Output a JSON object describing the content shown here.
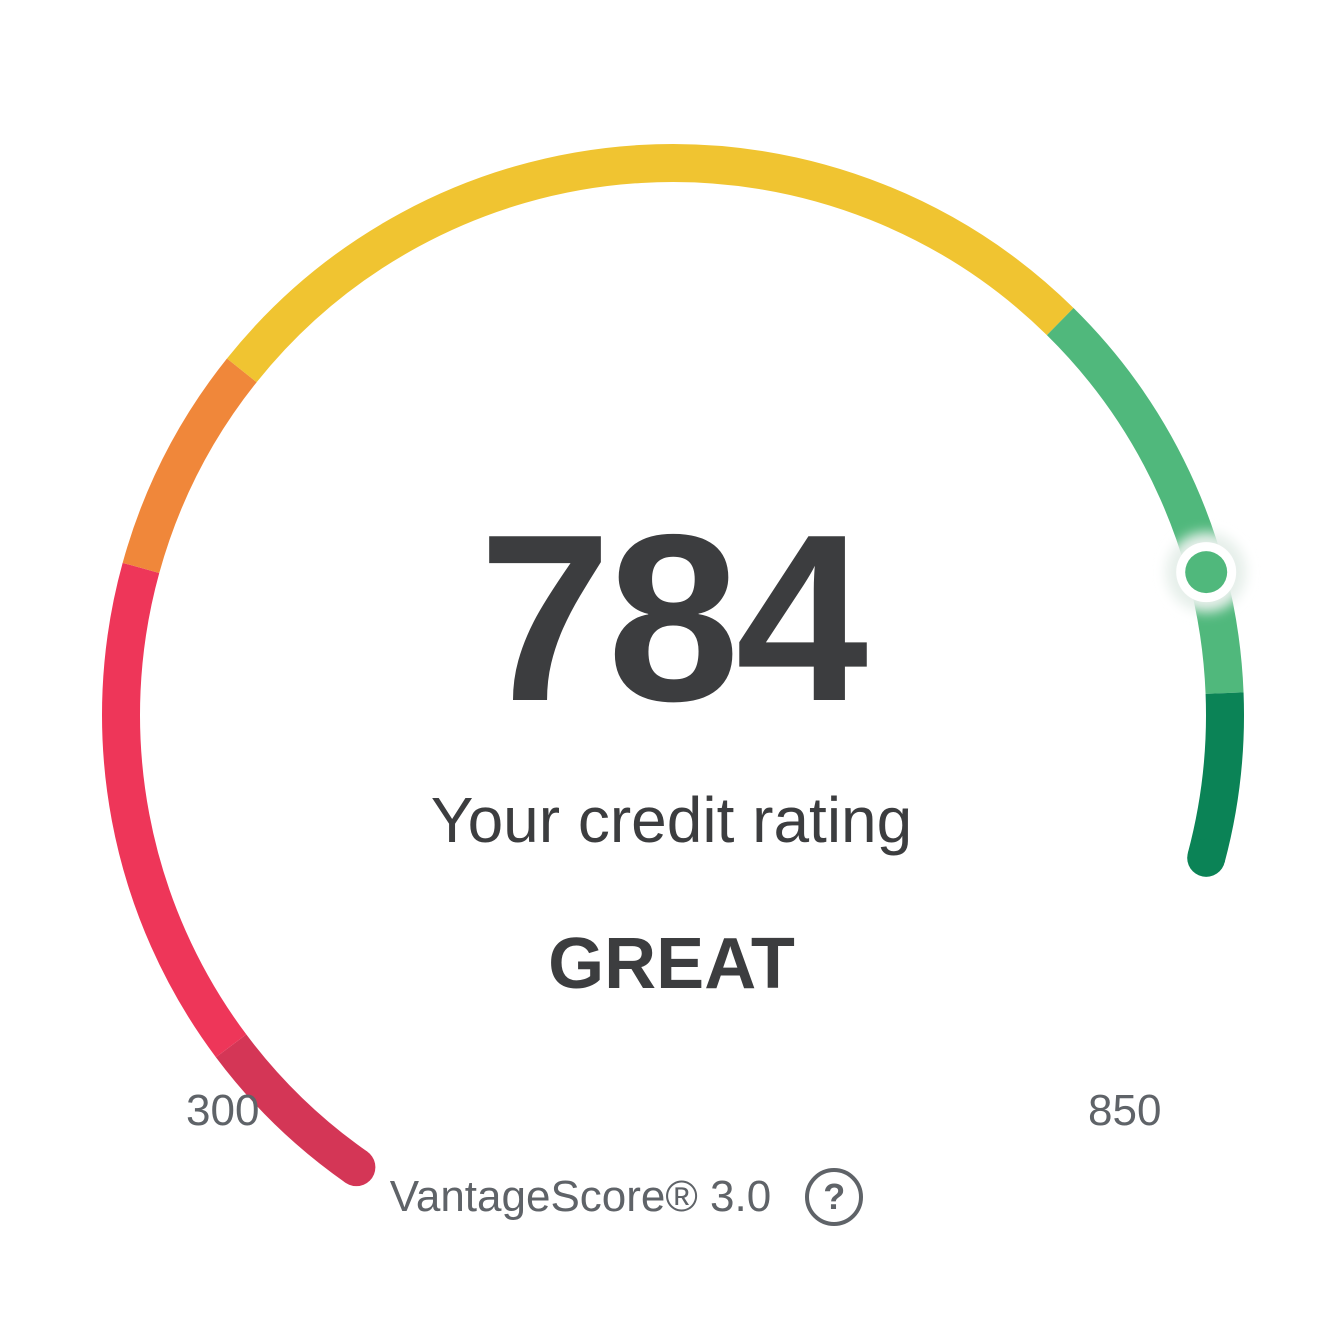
{
  "score": {
    "value": "784",
    "min": 300,
    "max": 850,
    "numeric_value": 784
  },
  "caption": "Your credit rating",
  "rating": "GREAT",
  "range": {
    "min_label": "300",
    "max_label": "850"
  },
  "footer": {
    "model": "VantageScore® 3.0",
    "help_icon": "question-circle-icon",
    "help_glyph": "?"
  },
  "colors": {
    "very_poor": "#d43656",
    "poor": "#ee3659",
    "fair": "#f0873a",
    "good": "#f0c431",
    "great": "#50b87c",
    "excellent": "#0b8356",
    "text": "#3c3d3f",
    "muted": "#5f6368"
  },
  "gauge_bands": [
    {
      "name": "very_poor",
      "from": 300,
      "to": 340
    },
    {
      "name": "poor",
      "from": 340,
      "to": 455
    },
    {
      "name": "fair",
      "from": 455,
      "to": 506
    },
    {
      "name": "good",
      "from": 506,
      "to": 717
    },
    {
      "name": "great",
      "from": 717,
      "to": 812
    },
    {
      "name": "excellent",
      "from": 812,
      "to": 850
    }
  ]
}
